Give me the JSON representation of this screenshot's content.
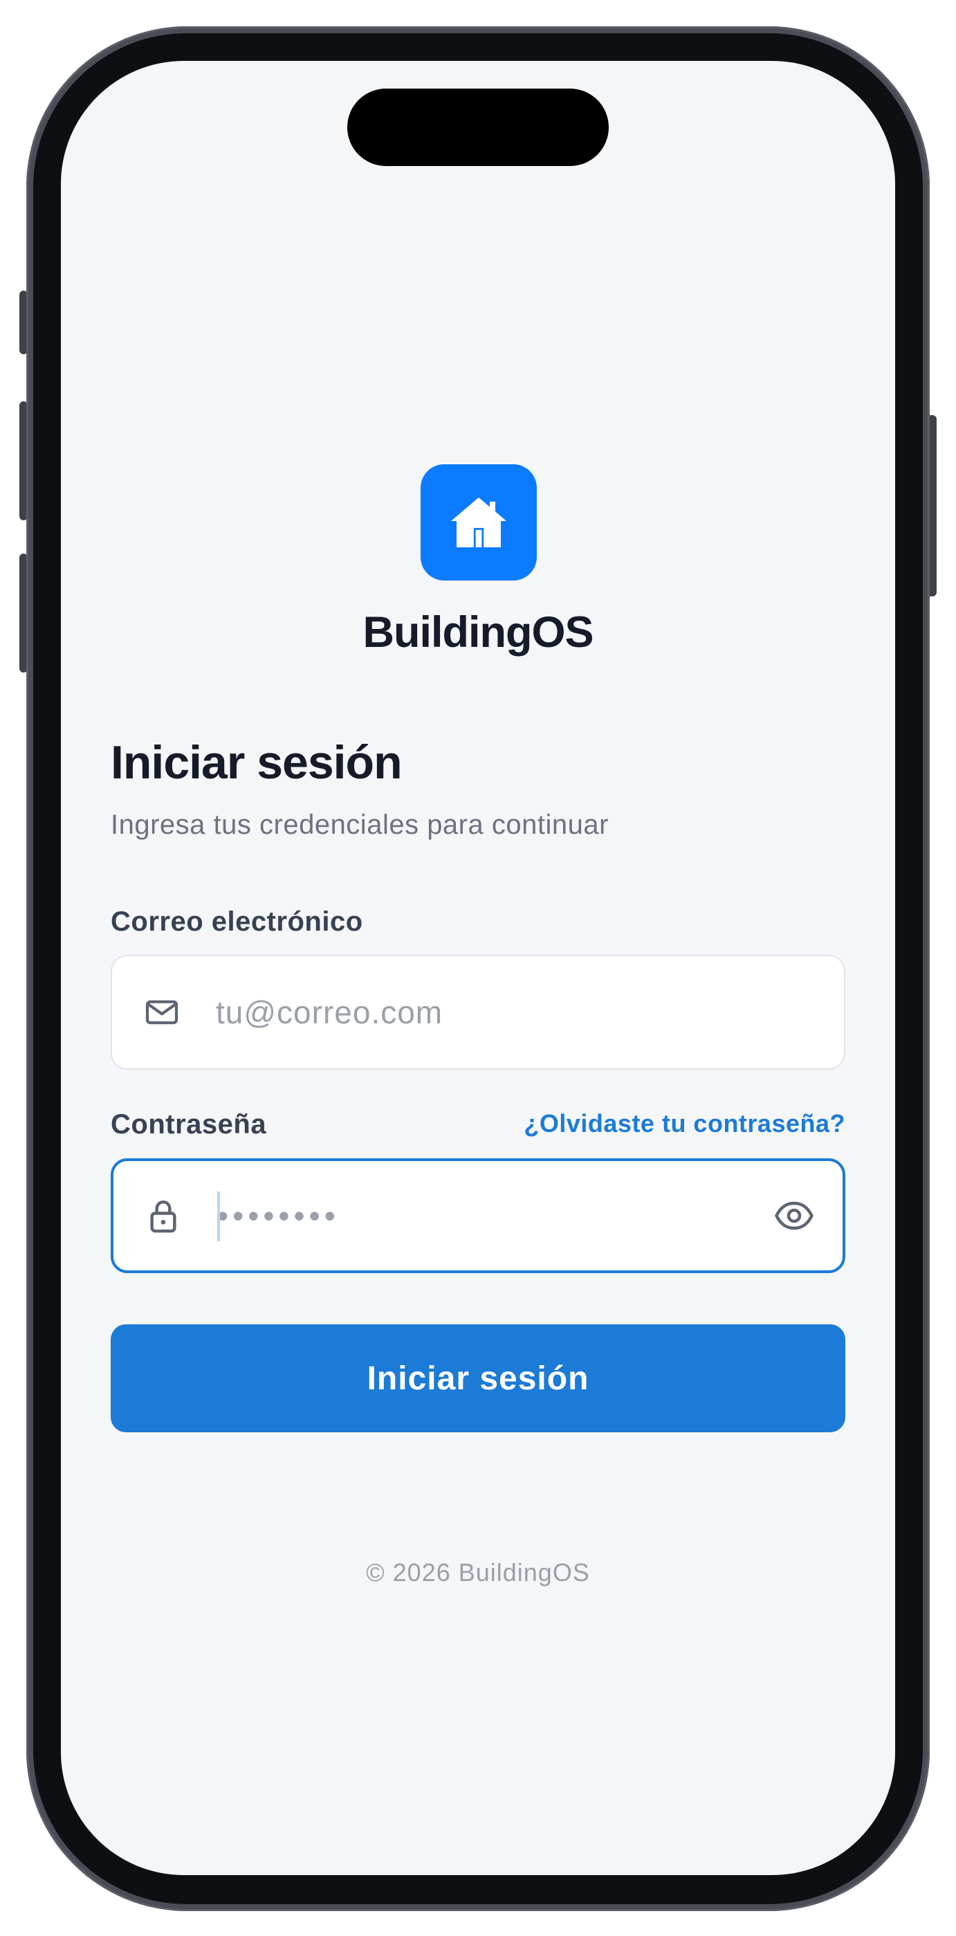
{
  "app": {
    "brand_name": "BuildingOS",
    "logo_icon": "house-icon",
    "accent_color": "#1c7bd6",
    "logo_color": "#0b7cff"
  },
  "login": {
    "title": "Iniciar sesión",
    "subtitle": "Ingresa tus credenciales para continuar",
    "email": {
      "label": "Correo electrónico",
      "placeholder": "tu@correo.com",
      "value": "",
      "icon": "mail-icon"
    },
    "password": {
      "label": "Contraseña",
      "placeholder": "••••••••",
      "value": "",
      "icon": "lock-icon",
      "toggle_icon": "eye-icon",
      "focused": true
    },
    "forgot_link": "¿Olvidaste tu contraseña?",
    "submit_label": "Iniciar sesión"
  },
  "footer": {
    "copyright": "© 2026 BuildingOS"
  }
}
